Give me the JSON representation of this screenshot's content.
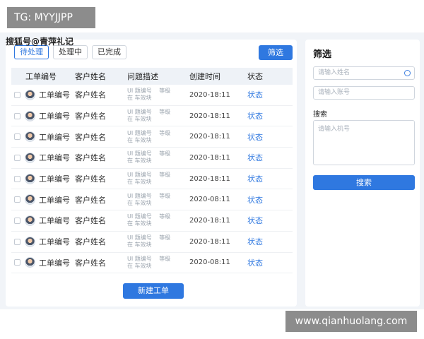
{
  "watermarks": {
    "tag": "TG: MYYJJPP",
    "source": "搜狐号@青萍礼记",
    "url": "www.qianhuolang.com"
  },
  "tabs": [
    "待处理",
    "处理中",
    "已完成"
  ],
  "filter_button": "筛选",
  "table": {
    "headers": [
      "工单编号",
      "客户姓名",
      "问题描述",
      "创建时间",
      "状态"
    ],
    "rows": [
      {
        "id": "工单编号",
        "name": "客户姓名",
        "desc": "UI 题编号　 等级\n在 车效块",
        "time": "2020-18:11",
        "status": "状态"
      },
      {
        "id": "工单编号",
        "name": "客户姓名",
        "desc": "UI 题编号　 等级\n在 车效块",
        "time": "2020-18:11",
        "status": "状态"
      },
      {
        "id": "工单编号",
        "name": "客户姓名",
        "desc": "UI 题编号　 等级\n在 车效块",
        "time": "2020-18:11",
        "status": "状态"
      },
      {
        "id": "工单编号",
        "name": "客户姓名",
        "desc": "UI 题编号　 等级\n在 车效块",
        "time": "2020-18:11",
        "status": "状态"
      },
      {
        "id": "工单编号",
        "name": "客户姓名",
        "desc": "UI 题编号　 等级\n在 车效块",
        "time": "2020-18:11",
        "status": "状态"
      },
      {
        "id": "工单编号",
        "name": "客户姓名",
        "desc": "UI 题编号　 等级\n在 车效块",
        "time": "2020-08:11",
        "status": "状态"
      },
      {
        "id": "工单编号",
        "name": "客户姓名",
        "desc": "UI 题编号　 等级\n在 车效块",
        "time": "2020-18:11",
        "status": "状态"
      },
      {
        "id": "工单编号",
        "name": "客户姓名",
        "desc": "UI 题编号　 等级\n在 车效块",
        "time": "2020-18:11",
        "status": "状态"
      },
      {
        "id": "工单编号",
        "name": "客户姓名",
        "desc": "UI 题编号　 等级\n在 车效块",
        "time": "2020-08:11",
        "status": "状态"
      }
    ]
  },
  "new_button": "新建工单",
  "side": {
    "title": "筛选",
    "name_placeholder": "请输入姓名",
    "card_placeholder": "请输入账号",
    "search_label": "搜索",
    "phone_placeholder": "请输入机号",
    "search_button": "搜索"
  },
  "colors": {
    "accent": "#2f78e0",
    "page_bg": "#f1f4f8"
  }
}
